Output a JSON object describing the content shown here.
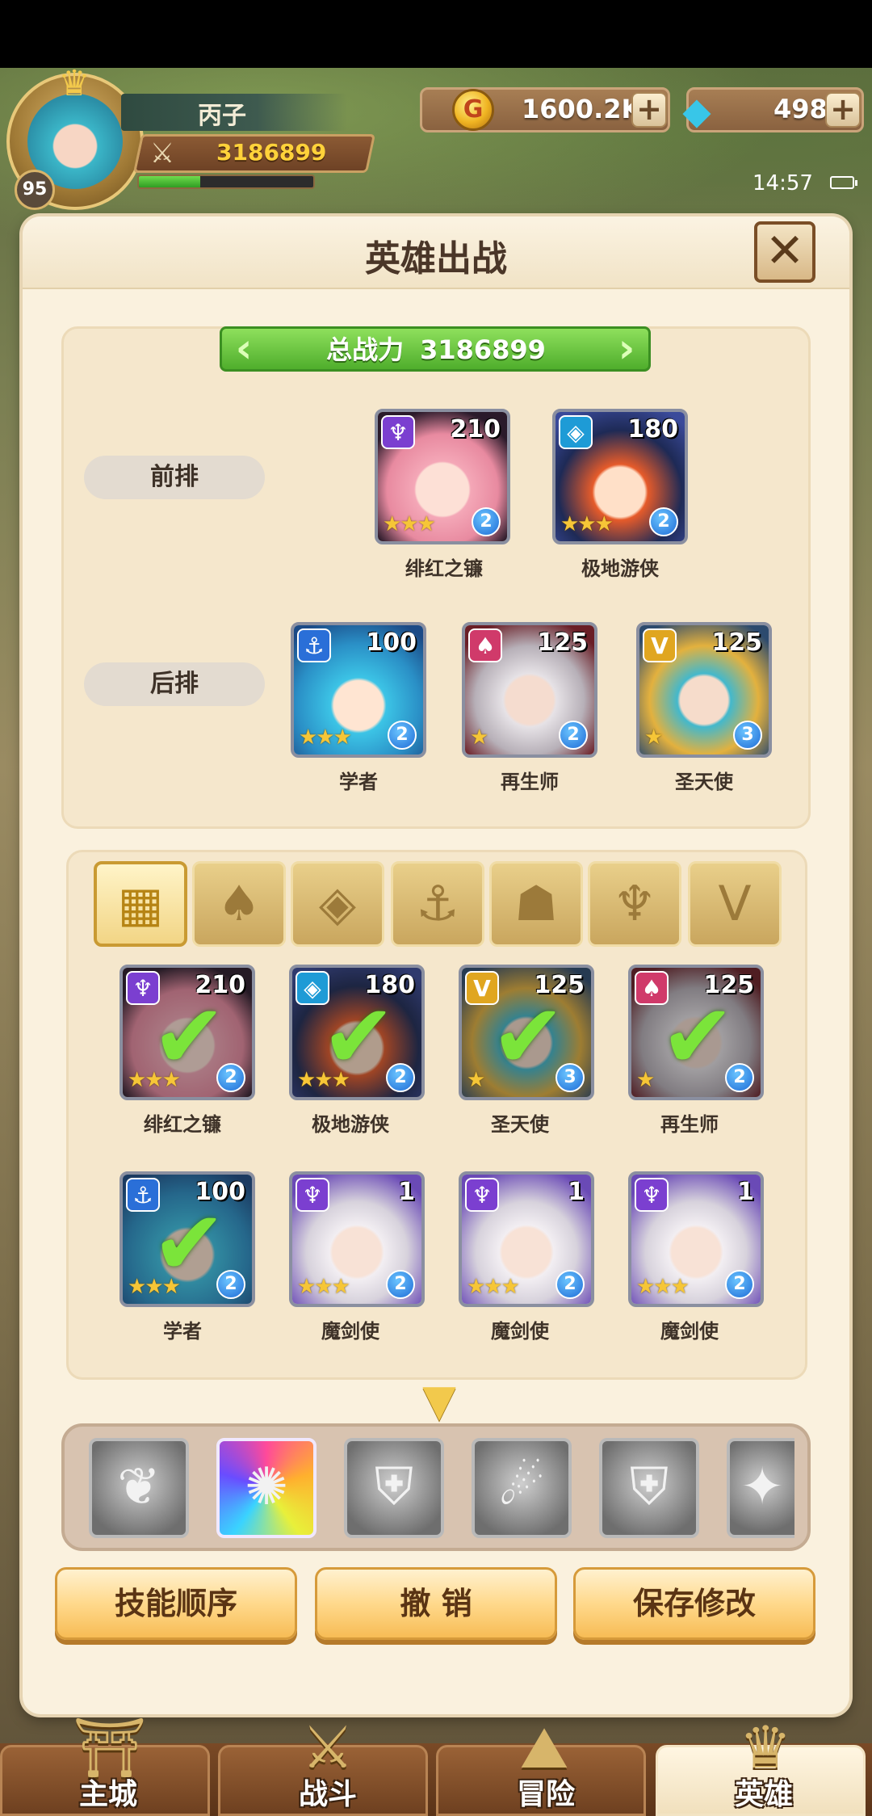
{
  "player": {
    "name": "丙子",
    "power": "3186899",
    "level": "95",
    "exp_fraction": 0.35
  },
  "currency": {
    "gold": "1600.2K",
    "gems": "498"
  },
  "status": {
    "time": "14:57"
  },
  "dialog": {
    "title": "英雄出战",
    "total_power_label": "总战力",
    "total_power_value": "3186899"
  },
  "formation": {
    "front_label": "前排",
    "back_label": "后排",
    "front": [
      {
        "name": "绯红之镰",
        "level": "210",
        "rank": "2",
        "stars": "★★★",
        "class_icon": "scythe-class-icon"
      },
      {
        "name": "极地游侠",
        "level": "180",
        "rank": "2",
        "stars": "★★★",
        "class_icon": "diamond-class-icon"
      }
    ],
    "back": [
      {
        "name": "学者",
        "level": "100",
        "rank": "2",
        "stars": "★★★",
        "class_icon": "anchor-class-icon"
      },
      {
        "name": "再生师",
        "level": "125",
        "rank": "2",
        "stars": "★",
        "class_icon": "lotus-class-icon"
      },
      {
        "name": "圣天使",
        "level": "125",
        "rank": "3",
        "stars": "★",
        "class_icon": "wing-class-icon"
      }
    ]
  },
  "filters": [
    {
      "name": "all-filter-icon",
      "glyph": "▦"
    },
    {
      "name": "lotus-filter-icon",
      "glyph": "♠"
    },
    {
      "name": "diamond-filter-icon",
      "glyph": "◈"
    },
    {
      "name": "anchor-filter-icon",
      "glyph": "⚓"
    },
    {
      "name": "beast-filter-icon",
      "glyph": "☗"
    },
    {
      "name": "scythe-filter-icon",
      "glyph": "♆"
    },
    {
      "name": "wing-filter-icon",
      "glyph": "V"
    }
  ],
  "pool": [
    {
      "name": "绯红之镰",
      "level": "210",
      "rank": "2",
      "stars": "★★★",
      "selected": true
    },
    {
      "name": "极地游侠",
      "level": "180",
      "rank": "2",
      "stars": "★★★",
      "selected": true
    },
    {
      "name": "圣天使",
      "level": "125",
      "rank": "3",
      "stars": "★",
      "selected": true
    },
    {
      "name": "再生师",
      "level": "125",
      "rank": "2",
      "stars": "★",
      "selected": true
    },
    {
      "name": "学者",
      "level": "100",
      "rank": "2",
      "stars": "★★★",
      "selected": true
    },
    {
      "name": "魔剑使",
      "level": "1",
      "rank": "2",
      "stars": "★★★",
      "selected": false
    },
    {
      "name": "魔剑使",
      "level": "1",
      "rank": "2",
      "stars": "★★★",
      "selected": false
    },
    {
      "name": "魔剑使",
      "level": "1",
      "rank": "2",
      "stars": "★★★",
      "selected": false
    }
  ],
  "skills": [
    {
      "name": "wing-slash-skill-icon",
      "glyph": "❦"
    },
    {
      "name": "prism-burst-skill-icon",
      "glyph": "✺"
    },
    {
      "name": "shield-guard-skill-icon",
      "glyph": "⛨"
    },
    {
      "name": "cannon-blast-skill-icon",
      "glyph": "☄"
    },
    {
      "name": "shield-crest-skill-icon",
      "glyph": "⛨"
    },
    {
      "name": "whirl-skill-icon",
      "glyph": "✦"
    }
  ],
  "actions": {
    "skill_order": "技能顺序",
    "undo": "撤 销",
    "save": "保存修改"
  },
  "nav": {
    "main_city": "主城",
    "battle": "战斗",
    "adventure": "冒险",
    "heroes": "英雄"
  }
}
